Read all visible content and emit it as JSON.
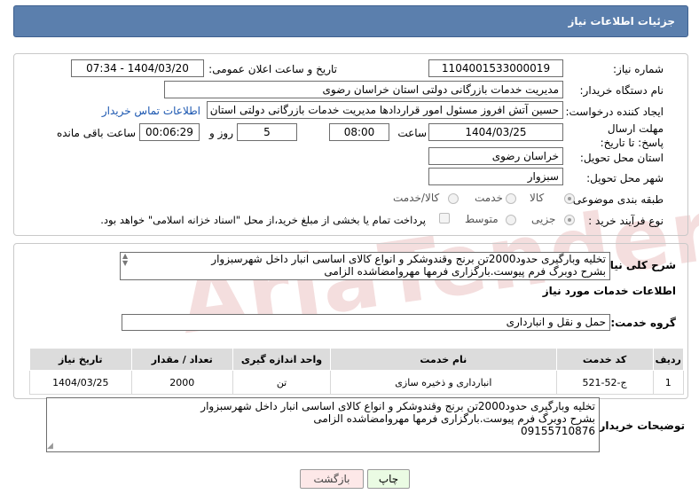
{
  "header": {
    "title": "جزئیات اطلاعات نیاز"
  },
  "fields": {
    "need_number_label": "شماره نیاز:",
    "need_number": "1104001533000019",
    "announce_label": "تاریخ و ساعت اعلان عمومی:",
    "announce_value": "1404/03/20 - 07:34",
    "buyer_org_label": "نام دستگاه خریدار:",
    "buyer_org": "مدیریت خدمات بازرگانی دولتی استان خراسان رضوی",
    "requester_label": "ایجاد کننده درخواست:",
    "requester": "حسین آتش افروز مسئول امور قراردادها مدیریت خدمات بازرگانی دولتی استان خراسان رضوی",
    "contact_link": "اطلاعات تماس خریدار",
    "deadline_label": "مهلت ارسال پاسخ: تا تاریخ:",
    "deadline_date": "1404/03/25",
    "time_label": "ساعت",
    "deadline_time": "08:00",
    "days_value": "5",
    "days_label": "روز و",
    "remaining_time": "00:06:29",
    "remaining_label": "ساعت باقی مانده",
    "province_label": "استان محل تحویل:",
    "province": "خراسان رضوی",
    "city_label": "شهر محل تحویل:",
    "city": "سبزوار",
    "category_label": "طبقه بندی موضوعی:",
    "category_options": [
      "کالا",
      "خدمت",
      "کالا/خدمت"
    ],
    "process_label": "نوع فرآیند خرید :",
    "process_options": [
      "جزیی",
      "متوسط"
    ],
    "payment_note": "پرداخت تمام یا بخشی از مبلغ خرید،از محل \"اسناد خزانه اسلامی\" خواهد بود."
  },
  "summary": {
    "label": "شرح کلی نیاز:",
    "line1": "تخلیه وبارگیری حدود2000تن برنج وقندوشکر و انواع کالای اساسی انبار داخل شهرسبزوار",
    "line2": "بشرح دوبرگ فرم پیوست.بارگزاری فرمها مهروامضاشده الزامی"
  },
  "services": {
    "title": "اطلاعات خدمات مورد نیاز",
    "group_label": "گروه خدمت:",
    "group_value": "حمل و نقل و انبارداری",
    "columns": [
      "ردیف",
      "کد خدمت",
      "نام خدمت",
      "واحد اندازه گیری",
      "تعداد / مقدار",
      "تاریخ نیاز"
    ],
    "rows": [
      {
        "idx": "1",
        "code": "ج-52-521",
        "name": "انبارداری و ذخیره سازی",
        "unit": "تن",
        "qty": "2000",
        "date": "1404/03/25"
      }
    ]
  },
  "buyer_notes": {
    "label": "توضیحات خریدار:",
    "line1": "تخلیه وبارگیری حدود2000تن برنج وقندوشکر و انواع کالای اساسی انبار داخل شهرسبزوار",
    "line2": "بشرح دوبرگ فرم پیوست.بارگزاری فرمها مهروامضاشده الزامی",
    "line3": "09155710876"
  },
  "buttons": {
    "print": "چاپ",
    "back": "بازگشت"
  },
  "watermark": "AriaTender.net",
  "colors": {
    "header": "#5b7fad",
    "link": "#1a56b0",
    "back_button": "#fde8e8",
    "print_button": "#eafbe3"
  }
}
